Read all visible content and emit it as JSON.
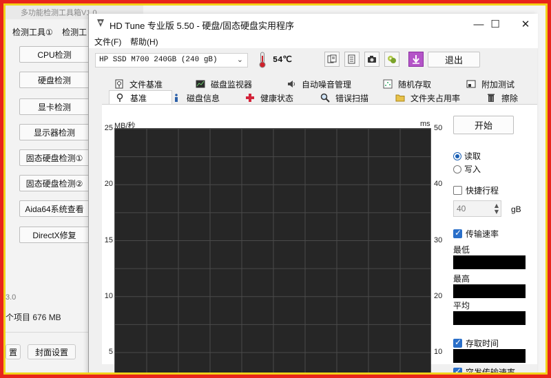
{
  "background_window": {
    "title": "多功能检测工具箱V1.0",
    "menu": [
      "检测工具①",
      "检测工"
    ],
    "buttons": [
      "CPU检测",
      "硬盘检测",
      "显卡检测",
      "显示器检测",
      "固态硬盘检测①",
      "固态硬盘检测②",
      "Aida64系统查看",
      "DirectX修复"
    ],
    "status_small": "3.0",
    "status": "个项目  676 MB",
    "footer_buttons": [
      "置",
      "封面设置"
    ]
  },
  "window": {
    "title": "HD Tune 专业版 5.50 - 硬盘/固态硬盘实用程序",
    "controls": {
      "minimize": "—",
      "maximize": "☐",
      "close": "✕"
    },
    "menu": [
      "文件(F)",
      "帮助(H)"
    ]
  },
  "toolbar": {
    "drive": "HP SSD M700 240GB (240 gB)",
    "temperature": "54℃",
    "exit_label": "退出"
  },
  "tabs_row1": [
    "文件基准",
    "磁盘监视器",
    "自动噪音管理",
    "随机存取",
    "附加测试"
  ],
  "tabs_row2": [
    "基准",
    "磁盘信息",
    "健康状态",
    "错误扫描",
    "文件夹占用率",
    "擦除"
  ],
  "chart_data": {
    "type": "line",
    "y_left_label": "MB/秒",
    "y_right_label": "ms",
    "y_left_ticks": [
      25,
      20,
      15,
      10,
      5
    ],
    "y_right_ticks": [
      50,
      40,
      30,
      20,
      10
    ],
    "ylim_left": [
      0,
      25
    ],
    "ylim_right": [
      0,
      50
    ],
    "grid": true,
    "series": []
  },
  "panel": {
    "start_label": "开始",
    "read_label": "读取",
    "write_label": "写入",
    "read_selected": true,
    "short_stroke_label": "快捷行程",
    "short_stroke_checked": false,
    "stroke_value": "40",
    "stroke_unit": "gB",
    "transfer_rate_label": "传输速率",
    "transfer_rate_checked": true,
    "min_label": "最低",
    "max_label": "最高",
    "avg_label": "平均",
    "access_time_label": "存取时间",
    "access_time_checked": true,
    "burst_label": "突发传输速率",
    "burst_checked": true
  },
  "colors": {
    "frame_red": "#e8251b",
    "frame_yellow": "#f2d21a",
    "graph_bg": "#262626",
    "grid_line": "#4a4a4a"
  }
}
